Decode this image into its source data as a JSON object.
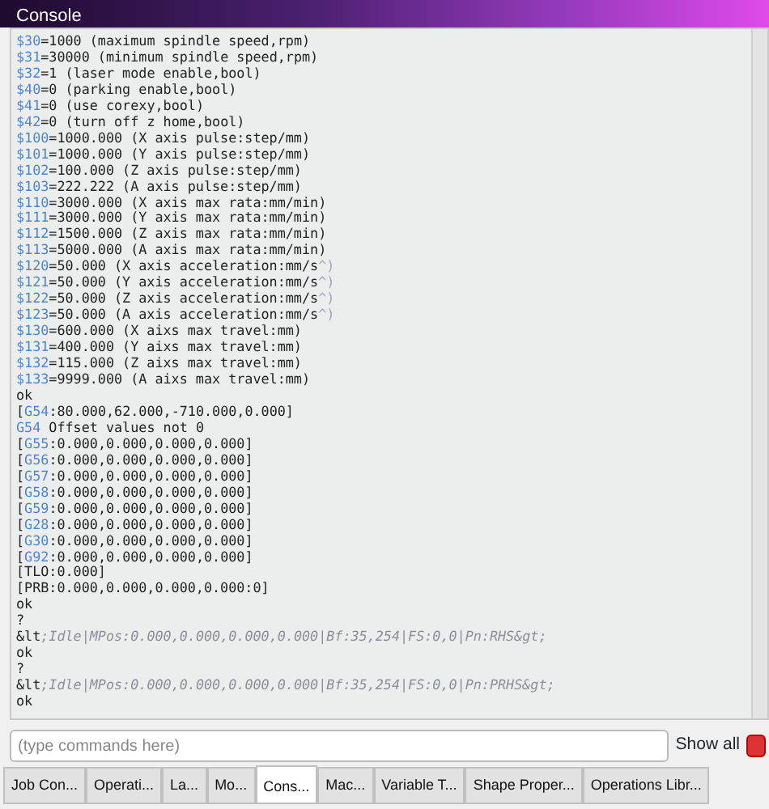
{
  "window": {
    "title": "Console"
  },
  "console_lines": [
    [
      {
        "kind": "key",
        "text": "$30"
      },
      {
        "kind": "text",
        "text": "=1000 (maximum spindle speed,rpm)"
      }
    ],
    [
      {
        "kind": "key",
        "text": "$31"
      },
      {
        "kind": "text",
        "text": "=30000 (minimum spindle speed,rpm)"
      }
    ],
    [
      {
        "kind": "key",
        "text": "$32"
      },
      {
        "kind": "text",
        "text": "=1 (laser mode enable,bool)"
      }
    ],
    [
      {
        "kind": "key",
        "text": "$40"
      },
      {
        "kind": "text",
        "text": "=0 (parking enable,bool)"
      }
    ],
    [
      {
        "kind": "key",
        "text": "$41"
      },
      {
        "kind": "text",
        "text": "=0 (use corexy,bool)"
      }
    ],
    [
      {
        "kind": "key",
        "text": "$42"
      },
      {
        "kind": "text",
        "text": "=0 (turn off z home,bool)"
      }
    ],
    [
      {
        "kind": "key",
        "text": "$100"
      },
      {
        "kind": "text",
        "text": "=1000.000 (X axis pulse:step/mm)"
      }
    ],
    [
      {
        "kind": "key",
        "text": "$101"
      },
      {
        "kind": "text",
        "text": "=1000.000 (Y axis pulse:step/mm)"
      }
    ],
    [
      {
        "kind": "key",
        "text": "$102"
      },
      {
        "kind": "text",
        "text": "=100.000 (Z axis pulse:step/mm)"
      }
    ],
    [
      {
        "kind": "key",
        "text": "$103"
      },
      {
        "kind": "text",
        "text": "=222.222 (A axis pulse:step/mm)"
      }
    ],
    [
      {
        "kind": "key",
        "text": "$110"
      },
      {
        "kind": "text",
        "text": "=3000.000 (X axis max rata:mm/min)"
      }
    ],
    [
      {
        "kind": "key",
        "text": "$111"
      },
      {
        "kind": "text",
        "text": "=3000.000 (Y axis max rata:mm/min)"
      }
    ],
    [
      {
        "kind": "key",
        "text": "$112"
      },
      {
        "kind": "text",
        "text": "=1500.000 (Z axis max rata:mm/min)"
      }
    ],
    [
      {
        "kind": "key",
        "text": "$113"
      },
      {
        "kind": "text",
        "text": "=5000.000 (A axis max rata:mm/min)"
      }
    ],
    [
      {
        "kind": "key",
        "text": "$120"
      },
      {
        "kind": "text",
        "text": "=50.000 (X axis acceleration:mm/s"
      },
      {
        "kind": "faint",
        "text": "^)"
      }
    ],
    [
      {
        "kind": "key",
        "text": "$121"
      },
      {
        "kind": "text",
        "text": "=50.000 (Y axis acceleration:mm/s"
      },
      {
        "kind": "faint",
        "text": "^)"
      }
    ],
    [
      {
        "kind": "key",
        "text": "$122"
      },
      {
        "kind": "text",
        "text": "=50.000 (Z axis acceleration:mm/s"
      },
      {
        "kind": "faint",
        "text": "^)"
      }
    ],
    [
      {
        "kind": "key",
        "text": "$123"
      },
      {
        "kind": "text",
        "text": "=50.000 (A axis acceleration:mm/s"
      },
      {
        "kind": "faint",
        "text": "^)"
      }
    ],
    [
      {
        "kind": "key",
        "text": "$130"
      },
      {
        "kind": "text",
        "text": "=600.000 (X aixs max travel:mm)"
      }
    ],
    [
      {
        "kind": "key",
        "text": "$131"
      },
      {
        "kind": "text",
        "text": "=400.000 (Y aixs max travel:mm)"
      }
    ],
    [
      {
        "kind": "key",
        "text": "$132"
      },
      {
        "kind": "text",
        "text": "=115.000 (Z aixs max travel:mm)"
      }
    ],
    [
      {
        "kind": "key",
        "text": "$133"
      },
      {
        "kind": "text",
        "text": "=9999.000 (A aixs max travel:mm)"
      }
    ],
    [
      {
        "kind": "text",
        "text": "ok"
      }
    ],
    [
      {
        "kind": "text",
        "text": "["
      },
      {
        "kind": "key",
        "text": "G54"
      },
      {
        "kind": "text",
        "text": ":80.000,62.000,-710.000,0.000]"
      }
    ],
    [
      {
        "kind": "key",
        "text": "G54"
      },
      {
        "kind": "text",
        "text": " Offset values not 0"
      }
    ],
    [
      {
        "kind": "text",
        "text": "["
      },
      {
        "kind": "key",
        "text": "G55"
      },
      {
        "kind": "text",
        "text": ":0.000,0.000,0.000,0.000]"
      }
    ],
    [
      {
        "kind": "text",
        "text": "["
      },
      {
        "kind": "key",
        "text": "G56"
      },
      {
        "kind": "text",
        "text": ":0.000,0.000,0.000,0.000]"
      }
    ],
    [
      {
        "kind": "text",
        "text": "["
      },
      {
        "kind": "key",
        "text": "G57"
      },
      {
        "kind": "text",
        "text": ":0.000,0.000,0.000,0.000]"
      }
    ],
    [
      {
        "kind": "text",
        "text": "["
      },
      {
        "kind": "key",
        "text": "G58"
      },
      {
        "kind": "text",
        "text": ":0.000,0.000,0.000,0.000]"
      }
    ],
    [
      {
        "kind": "text",
        "text": "["
      },
      {
        "kind": "key",
        "text": "G59"
      },
      {
        "kind": "text",
        "text": ":0.000,0.000,0.000,0.000]"
      }
    ],
    [
      {
        "kind": "text",
        "text": "["
      },
      {
        "kind": "key",
        "text": "G28"
      },
      {
        "kind": "text",
        "text": ":0.000,0.000,0.000,0.000]"
      }
    ],
    [
      {
        "kind": "text",
        "text": "["
      },
      {
        "kind": "key",
        "text": "G30"
      },
      {
        "kind": "text",
        "text": ":0.000,0.000,0.000,0.000]"
      }
    ],
    [
      {
        "kind": "text",
        "text": "["
      },
      {
        "kind": "key",
        "text": "G92"
      },
      {
        "kind": "text",
        "text": ":0.000,0.000,0.000,0.000]"
      }
    ],
    [
      {
        "kind": "text",
        "text": "[TLO:0.000]"
      }
    ],
    [
      {
        "kind": "text",
        "text": "[PRB:0.000,0.000,0.000,0.000:0]"
      }
    ],
    [
      {
        "kind": "text",
        "text": "ok"
      }
    ],
    [
      {
        "kind": "text",
        "text": "?"
      }
    ],
    [
      {
        "kind": "text",
        "text": "&lt"
      },
      {
        "kind": "muted",
        "text": ";Idle|MPos:0.000,0.000,0.000,0.000|Bf:35,254|FS:0,0|Pn:RHS&gt;"
      }
    ],
    [
      {
        "kind": "text",
        "text": "ok"
      }
    ],
    [
      {
        "kind": "text",
        "text": "?"
      }
    ],
    [
      {
        "kind": "text",
        "text": "&lt"
      },
      {
        "kind": "muted",
        "text": ";Idle|MPos:0.000,0.000,0.000,0.000|Bf:35,254|FS:0,0|Pn:PRHS&gt;"
      }
    ],
    [
      {
        "kind": "text",
        "text": "ok"
      }
    ]
  ],
  "command_input": {
    "placeholder": "(type commands here)"
  },
  "show_all": {
    "label": "Show all",
    "on": false
  },
  "tabs": [
    {
      "label": "Job Con...",
      "selected": false
    },
    {
      "label": "Operati...",
      "selected": false
    },
    {
      "label": "La...",
      "selected": false
    },
    {
      "label": "Mo...",
      "selected": false
    },
    {
      "label": "Cons...",
      "selected": true
    },
    {
      "label": "Mac...",
      "selected": false
    },
    {
      "label": "Variable T...",
      "selected": false
    },
    {
      "label": "Shape Proper...",
      "selected": false
    },
    {
      "label": "Operations Libr...",
      "selected": false
    }
  ]
}
